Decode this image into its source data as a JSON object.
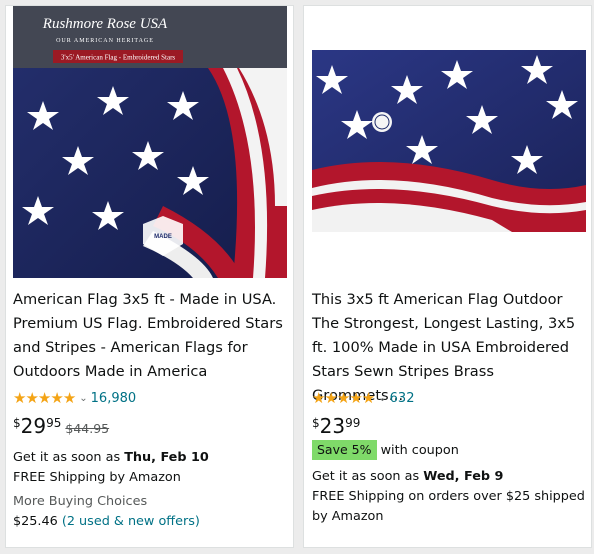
{
  "products": [
    {
      "image_alt": "Rushmore Rose USA American flag",
      "image_brand": "Rushmore Rose USA",
      "image_tagline": "OUR AMERICAN HERITAGE",
      "image_banner": "3'x5' American Flag - Embroidered Stars",
      "image_badge": "MADE",
      "title": "American Flag 3x5 ft - Made in USA. Premium US Flag. Embroidered Stars and Stripes - American Flags for Outdoors Made in America",
      "rating": 5,
      "review_count": "16,980",
      "price_symbol": "$",
      "price_whole": "29",
      "price_fraction": "95",
      "list_price": "$44.95",
      "delivery_prefix": "Get it as soon as",
      "delivery_date": "Thu, Feb 10",
      "shipping": "FREE Shipping by Amazon",
      "buying_choices_label": "More Buying Choices",
      "buying_choices_price": "$25.46",
      "buying_choices_link": "(2 used & new offers)"
    },
    {
      "image_alt": "American flag with embroidered stars",
      "title": "This 3x5 ft American Flag Outdoor The Strongest, Longest Lasting, 3x5 ft. 100% Made in USA Embroidered Stars Sewn Stripes Brass Grommets…",
      "rating": 5,
      "review_count": "632",
      "price_symbol": "$",
      "price_whole": "23",
      "price_fraction": "99",
      "coupon_badge": "Save 5%",
      "coupon_text": "with coupon",
      "delivery_prefix": "Get it as soon as",
      "delivery_date": "Wed, Feb 9",
      "shipping_line1": "FREE Shipping on orders over $25 shipped",
      "shipping_line2": "by Amazon"
    }
  ],
  "colors": {
    "star_rating": "#f4a416",
    "link": "#007185",
    "coupon_bg": "#7fda69",
    "flag_blue": "#1d2a6a",
    "flag_red": "#b3162c"
  },
  "icons": {
    "star": "star-icon",
    "chevron": "chevron-down-icon"
  }
}
